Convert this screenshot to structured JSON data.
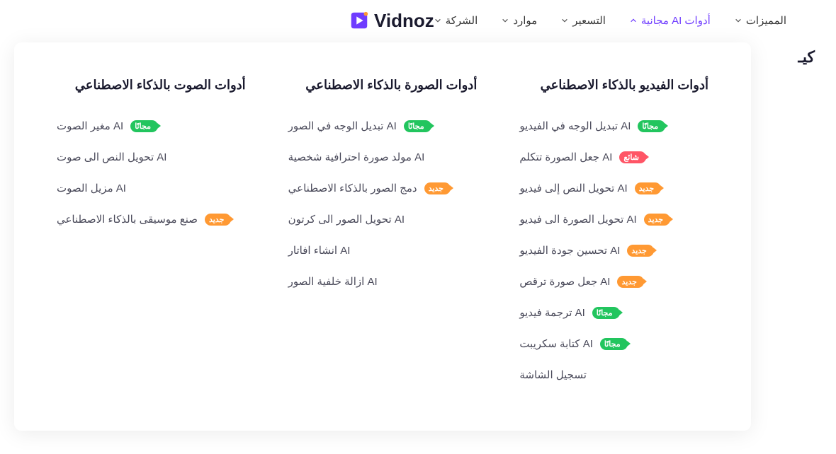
{
  "brand": "Vidnoz",
  "nav": {
    "features": "المميزات",
    "free_tools": "أدوات AI مجانية",
    "pricing": "التسعير",
    "resources": "موارد",
    "company": "الشركة"
  },
  "partial_heading": "كيـ",
  "badges": {
    "free": "مجانًا",
    "new": "جديد",
    "popular": "شائع"
  },
  "menu": {
    "columns": [
      {
        "title": "أدوات الفيديو بالذكاء الاصطناعي",
        "items": [
          {
            "label": "AI تبديل الوجه في الفيديو",
            "badge": "free"
          },
          {
            "label": "AI جعل الصورة تتكلم",
            "badge": "popular"
          },
          {
            "label": "AI تحويل النص إلى فيديو",
            "badge": "new"
          },
          {
            "label": "AI تحويل الصورة الى فيديو",
            "badge": "new"
          },
          {
            "label": "AI تحسين جودة الفيديو",
            "badge": "new"
          },
          {
            "label": "AI جعل صورة ترقص",
            "badge": "new"
          },
          {
            "label": "AI ترجمة فيديو",
            "badge": "free"
          },
          {
            "label": "AI كتابة سكريبت",
            "badge": "free"
          },
          {
            "label": "تسجيل الشاشة",
            "badge": null
          }
        ]
      },
      {
        "title": "أدوات الصورة بالذكاء الاصطناعي",
        "items": [
          {
            "label": "AI تبديل الوجه في الصور",
            "badge": "free"
          },
          {
            "label": "AI مولد صورة احترافية شخصية",
            "badge": null
          },
          {
            "label": "دمج الصور بالذكاء الاصطناعي",
            "badge": "new"
          },
          {
            "label": "AI تحويل الصور الى كرتون",
            "badge": null
          },
          {
            "label": "AI انشاء افاتار",
            "badge": null
          },
          {
            "label": "AI ازالة خلفية الصور",
            "badge": null
          }
        ]
      },
      {
        "title": "أدوات الصوت بالذكاء الاصطناعي",
        "items": [
          {
            "label": "AI مغير الصوت",
            "badge": "free"
          },
          {
            "label": "AI تحويل النص الى صوت",
            "badge": null
          },
          {
            "label": "AI مزيل الصوت",
            "badge": null
          },
          {
            "label": "صنع موسيقى بالذكاء الاصطناعي",
            "badge": "new"
          }
        ]
      }
    ]
  }
}
